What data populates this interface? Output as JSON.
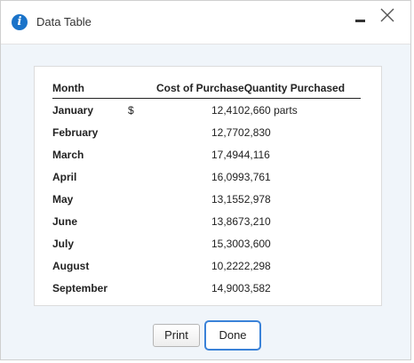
{
  "dialog": {
    "title": "Data Table",
    "icon": "info-icon"
  },
  "table": {
    "headers": {
      "month": "Month",
      "cost": "Cost of Purchase",
      "quantity": "Quantity Purchased"
    },
    "currency_symbol": "$",
    "rows": [
      {
        "month": "January",
        "cost": "12,410",
        "quantity": "2,660 parts"
      },
      {
        "month": "February",
        "cost": "12,770",
        "quantity": "2,830"
      },
      {
        "month": "March",
        "cost": "17,494",
        "quantity": "4,116"
      },
      {
        "month": "April",
        "cost": "16,099",
        "quantity": "3,761"
      },
      {
        "month": "May",
        "cost": "13,155",
        "quantity": "2,978"
      },
      {
        "month": "June",
        "cost": "13,867",
        "quantity": "3,210"
      },
      {
        "month": "July",
        "cost": "15,300",
        "quantity": "3,600"
      },
      {
        "month": "August",
        "cost": "10,222",
        "quantity": "2,298"
      },
      {
        "month": "September",
        "cost": "14,900",
        "quantity": "3,582"
      }
    ]
  },
  "buttons": {
    "print": "Print",
    "done": "Done"
  },
  "colors": {
    "accent": "#3a82d8",
    "info_icon": "#1a73c9",
    "content_bg": "#f0f5fa"
  }
}
